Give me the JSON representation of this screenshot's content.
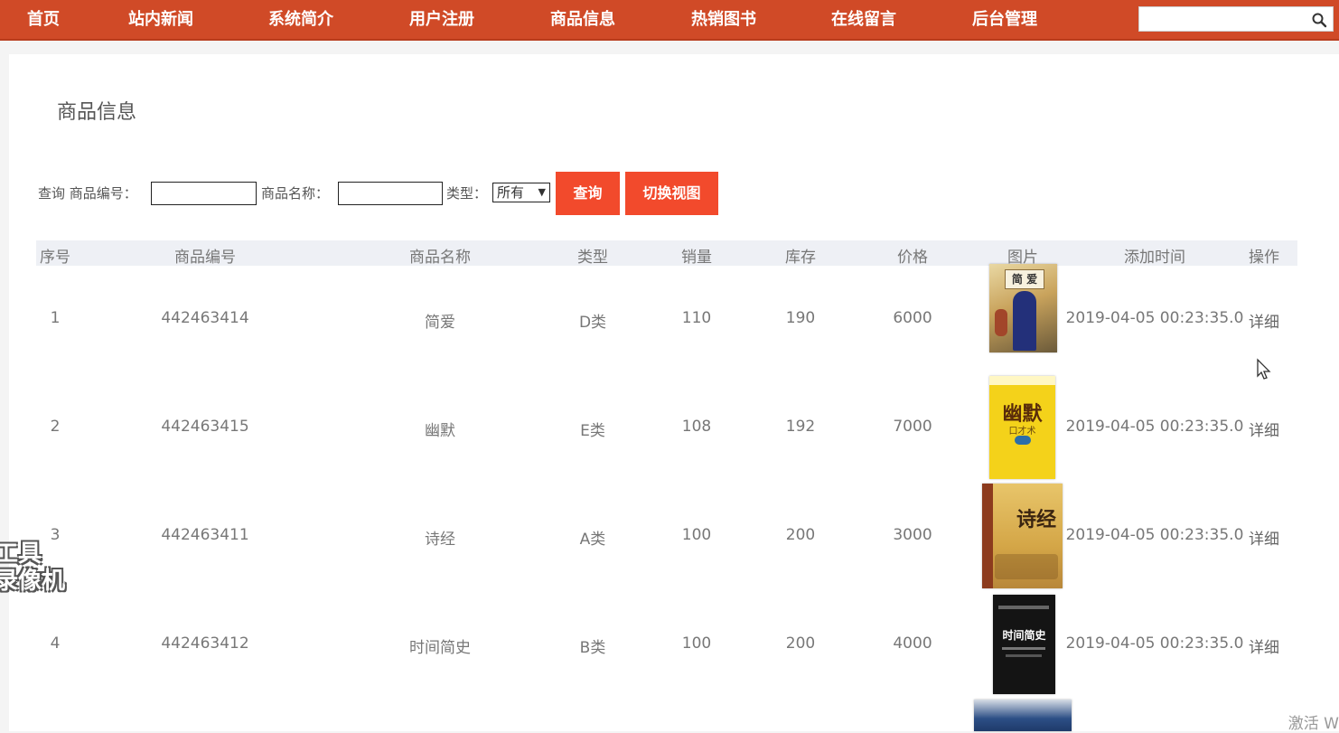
{
  "nav": {
    "items": [
      "首页",
      "站内新闻",
      "系统简介",
      "用户注册",
      "商品信息",
      "热销图书",
      "在线留言",
      "后台管理"
    ],
    "search_value": ""
  },
  "page": {
    "title": "商品信息"
  },
  "filters": {
    "query_label": "查询 商品编号：",
    "name_label": "商品名称：",
    "type_label": "类型：",
    "type_selected": "所有",
    "search_button": "查询",
    "switch_button": "切换视图"
  },
  "table": {
    "headers": [
      "序号",
      "商品编号",
      "商品名称",
      "类型",
      "销量",
      "库存",
      "价格",
      "图片",
      "添加时间",
      "操作"
    ],
    "rows": [
      {
        "index": "1",
        "code": "442463414",
        "name": "简爱",
        "type": "D类",
        "sales": "110",
        "stock": "190",
        "price": "6000",
        "cover_title": "简 爱",
        "added": "2019-04-05 00:23:35.0",
        "action": "详细"
      },
      {
        "index": "2",
        "code": "442463415",
        "name": "幽默",
        "type": "E类",
        "sales": "108",
        "stock": "192",
        "price": "7000",
        "cover_title": "幽默",
        "cover_sub": "口才术",
        "added": "2019-04-05 00:23:35.0",
        "action": "详细"
      },
      {
        "index": "3",
        "code": "442463411",
        "name": "诗经",
        "type": "A类",
        "sales": "100",
        "stock": "200",
        "price": "3000",
        "cover_title": "诗经",
        "added": "2019-04-05 00:23:35.0",
        "action": "详细"
      },
      {
        "index": "4",
        "code": "442463412",
        "name": "时间简史",
        "type": "B类",
        "sales": "100",
        "stock": "200",
        "price": "4000",
        "cover_title": "时间简史",
        "added": "2019-04-05 00:23:35.0",
        "action": "详细"
      }
    ]
  },
  "overlay": {
    "stamp_line1": "工具",
    "stamp_line2": "录像机",
    "watermark": "激活 W"
  },
  "colors": {
    "nav_bg": "#d04a27",
    "button_bg": "#f24a2c",
    "header_bg": "#eef0f5"
  }
}
